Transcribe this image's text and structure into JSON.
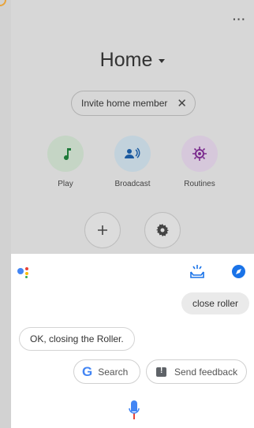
{
  "home": {
    "title": "Home",
    "invite_label": "Invite home member",
    "actions": [
      {
        "label": "Play",
        "icon": "music-note-icon",
        "color": "#c9d7c9"
      },
      {
        "label": "Broadcast",
        "icon": "broadcast-icon",
        "color": "#c7d4dc"
      },
      {
        "label": "Routines",
        "icon": "routines-icon",
        "color": "#d8cbdd"
      }
    ]
  },
  "assistant": {
    "user_message": "close roller",
    "assistant_reply": "OK, closing the Roller.",
    "suggestions": {
      "search_label": "Search",
      "feedback_label": "Send feedback"
    }
  },
  "colors": {
    "accent_blue": "#1a73e8",
    "google_red": "#ea4335",
    "google_yellow": "#fbbc04",
    "google_green": "#34a853"
  }
}
